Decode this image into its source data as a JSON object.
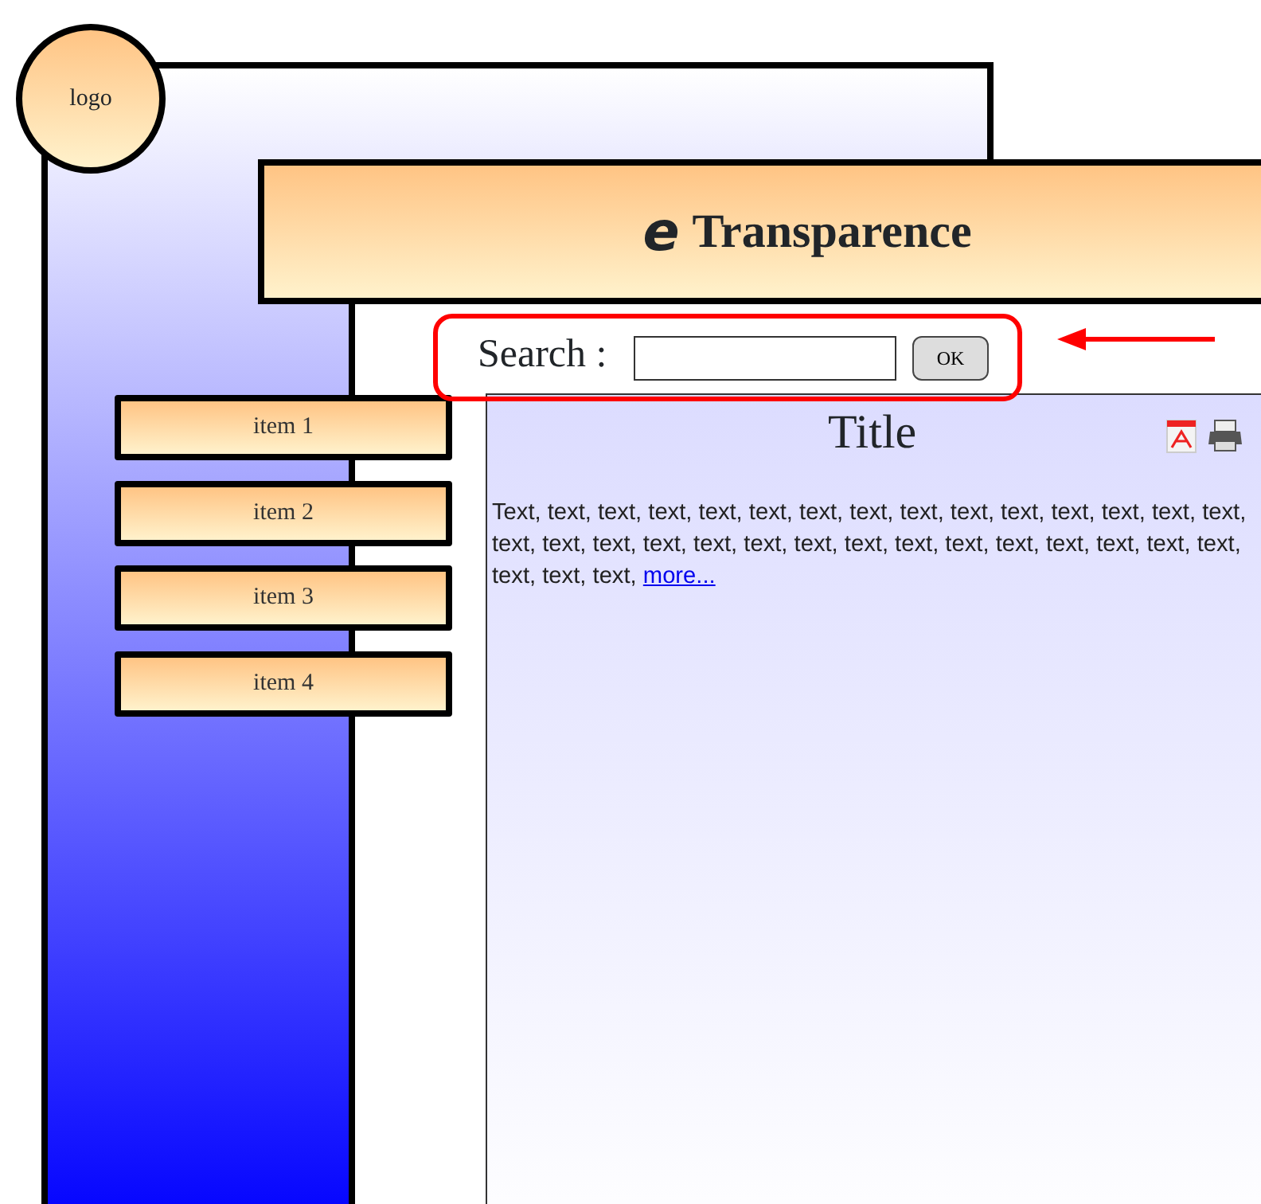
{
  "logo": {
    "text": "logo"
  },
  "header": {
    "mark": "e",
    "title": "Transparence"
  },
  "search": {
    "label": "Search :",
    "button": "OK"
  },
  "menu": {
    "items": [
      {
        "label": "item 1"
      },
      {
        "label": "item 2"
      },
      {
        "label": "item 3"
      },
      {
        "label": "item 4"
      }
    ]
  },
  "content": {
    "title": "Title",
    "body": "Text, text, text, text, text, text, text, text, text, text, text, text, text, text, text, text, text, text, text, text, text, text, text, text, text, text, text, text, text, text, text, text, text,",
    "link": "more..."
  }
}
